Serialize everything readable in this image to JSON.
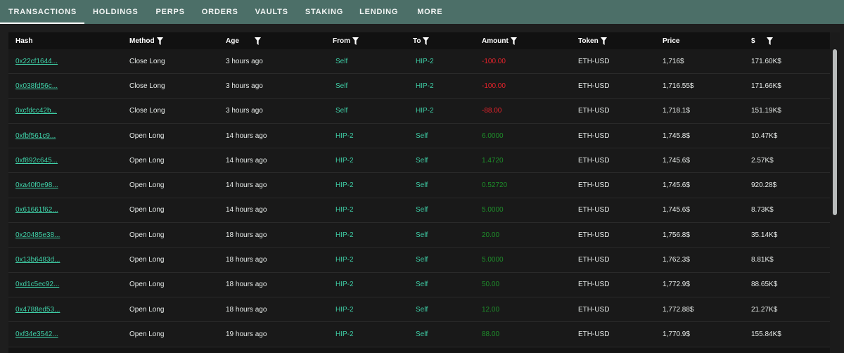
{
  "tabs": [
    {
      "label": "TRANSACTIONS",
      "active": true
    },
    {
      "label": "HOLDINGS",
      "active": false
    },
    {
      "label": "PERPS",
      "active": false
    },
    {
      "label": "ORDERS",
      "active": false
    },
    {
      "label": "VAULTS",
      "active": false
    },
    {
      "label": "STAKING",
      "active": false
    },
    {
      "label": "LENDING",
      "active": false
    },
    {
      "label": "MORE",
      "active": false
    }
  ],
  "table": {
    "columns": [
      {
        "key": "hash",
        "label": "Hash",
        "filter": false
      },
      {
        "key": "method",
        "label": "Method",
        "filter": true
      },
      {
        "key": "age",
        "label": "Age",
        "filter": true
      },
      {
        "key": "from",
        "label": "From",
        "filter": true
      },
      {
        "key": "to",
        "label": "To",
        "filter": true
      },
      {
        "key": "amount",
        "label": "Amount",
        "filter": true
      },
      {
        "key": "token",
        "label": "Token",
        "filter": true
      },
      {
        "key": "price",
        "label": "Price",
        "filter": false
      },
      {
        "key": "usd",
        "label": "$",
        "filter": true
      }
    ],
    "rows": [
      {
        "hash": "0x22cf1644...",
        "method": "Close Long",
        "age": "3 hours ago",
        "from": "Self",
        "to": "HIP-2",
        "amount": "-100.00",
        "sign": "neg",
        "token": "ETH-USD",
        "price": "1,716$",
        "usd": "171.60K$"
      },
      {
        "hash": "0x038fd56c...",
        "method": "Close Long",
        "age": "3 hours ago",
        "from": "Self",
        "to": "HIP-2",
        "amount": "-100.00",
        "sign": "neg",
        "token": "ETH-USD",
        "price": "1,716.55$",
        "usd": "171.66K$"
      },
      {
        "hash": "0xcfdcc42b...",
        "method": "Close Long",
        "age": "3 hours ago",
        "from": "Self",
        "to": "HIP-2",
        "amount": "-88.00",
        "sign": "neg",
        "token": "ETH-USD",
        "price": "1,718.1$",
        "usd": "151.19K$"
      },
      {
        "hash": "0xfbf561c9...",
        "method": "Open Long",
        "age": "14 hours ago",
        "from": "HIP-2",
        "to": "Self",
        "amount": "6.0000",
        "sign": "pos",
        "token": "ETH-USD",
        "price": "1,745.8$",
        "usd": "10.47K$"
      },
      {
        "hash": "0xf892c645...",
        "method": "Open Long",
        "age": "14 hours ago",
        "from": "HIP-2",
        "to": "Self",
        "amount": "1.4720",
        "sign": "pos",
        "token": "ETH-USD",
        "price": "1,745.6$",
        "usd": "2.57K$"
      },
      {
        "hash": "0xa40f0e98...",
        "method": "Open Long",
        "age": "14 hours ago",
        "from": "HIP-2",
        "to": "Self",
        "amount": "0.52720",
        "sign": "pos",
        "token": "ETH-USD",
        "price": "1,745.6$",
        "usd": "920.28$"
      },
      {
        "hash": "0x61661f62...",
        "method": "Open Long",
        "age": "14 hours ago",
        "from": "HIP-2",
        "to": "Self",
        "amount": "5.0000",
        "sign": "pos",
        "token": "ETH-USD",
        "price": "1,745.6$",
        "usd": "8.73K$"
      },
      {
        "hash": "0x20485e38...",
        "method": "Open Long",
        "age": "18 hours ago",
        "from": "HIP-2",
        "to": "Self",
        "amount": "20.00",
        "sign": "pos",
        "token": "ETH-USD",
        "price": "1,756.8$",
        "usd": "35.14K$"
      },
      {
        "hash": "0x13b6483d...",
        "method": "Open Long",
        "age": "18 hours ago",
        "from": "HIP-2",
        "to": "Self",
        "amount": "5.0000",
        "sign": "pos",
        "token": "ETH-USD",
        "price": "1,762.3$",
        "usd": "8.81K$"
      },
      {
        "hash": "0xd1c5ec92...",
        "method": "Open Long",
        "age": "18 hours ago",
        "from": "HIP-2",
        "to": "Self",
        "amount": "50.00",
        "sign": "pos",
        "token": "ETH-USD",
        "price": "1,772.9$",
        "usd": "88.65K$"
      },
      {
        "hash": "0x4788ed53...",
        "method": "Open Long",
        "age": "18 hours ago",
        "from": "HIP-2",
        "to": "Self",
        "amount": "12.00",
        "sign": "pos",
        "token": "ETH-USD",
        "price": "1,772.88$",
        "usd": "21.27K$"
      },
      {
        "hash": "0xf34e3542...",
        "method": "Open Long",
        "age": "19 hours ago",
        "from": "HIP-2",
        "to": "Self",
        "amount": "88.00",
        "sign": "pos",
        "token": "ETH-USD",
        "price": "1,770.9$",
        "usd": "155.84K$"
      }
    ]
  },
  "icons": {
    "column_filter": "filter-funnel-icon"
  },
  "colors": {
    "tabbar": "#4c6f68",
    "link": "#3fd1a8",
    "negative": "#e8232b",
    "positive": "#1e8f2a"
  }
}
